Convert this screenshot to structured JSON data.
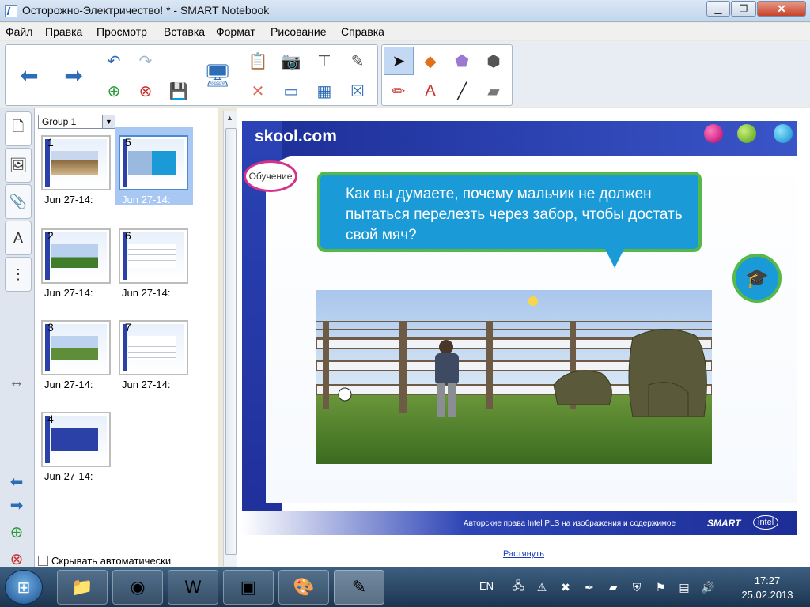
{
  "window": {
    "title": "Осторожно-Электричество! * - SMART Notebook",
    "min_symbol": "▁",
    "max_symbol": "❐",
    "close_symbol": "✕"
  },
  "menu": [
    "Файл",
    "Правка",
    "Просмотр",
    "Вставка",
    "Формат",
    "Рисование",
    "Справка"
  ],
  "pages_panel": {
    "group_select": "Group 1",
    "thumbnails": [
      {
        "number": "1",
        "label": "Jun 27-14:"
      },
      {
        "number": "5",
        "label": "Jun 27-14:",
        "selected": true
      },
      {
        "number": "2",
        "label": "Jun 27-14:"
      },
      {
        "number": "6",
        "label": "Jun 27-14:"
      },
      {
        "number": "3",
        "label": "Jun 27-14:"
      },
      {
        "number": "7",
        "label": "Jun 27-14:"
      },
      {
        "number": "4",
        "label": "Jun 27-14:"
      }
    ],
    "autohide_label": "Скрывать автоматически"
  },
  "slide": {
    "logo": "skool.com",
    "tag": "Обучение",
    "question": "Как вы думаете, почему мальчик не должен пытаться перелезть через забор, чтобы достать свой мяч?",
    "copyright": "Авторские права Intel PLS на изображения и содержимое",
    "smart_logo": "SMART",
    "intel_logo": "intel",
    "stretch_link": "Растянуть"
  },
  "taskbar": {
    "lang": "EN",
    "time": "17:27",
    "date": "25.02.2013"
  },
  "colors": {
    "slide_blue": "#1c2d96",
    "bubble_blue": "#1a9ad6",
    "bubble_border": "#56b848",
    "tag_border": "#d2328a"
  }
}
